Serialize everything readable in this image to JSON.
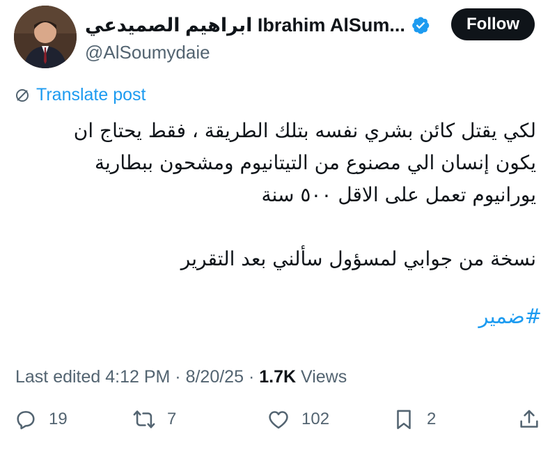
{
  "author": {
    "display_name": "ابراهيم الصميدعي Ibrahim AlSum...",
    "handle": "@AlSoumydaie",
    "verified": true
  },
  "follow_label": "Follow",
  "translate_label": "Translate post",
  "post": {
    "lines": [
      "لكي يقتل كائن بشري  نفسه بتلك الطريقة ، فقط يحتاج ان",
      "يكون إنسان الي مصنوع من التيتانيوم ومشحون ببطارية",
      "يورانيوم تعمل على الاقل ٥٠٠ سنة",
      "نسخة من جوابي لمسؤول سألني  بعد التقرير"
    ],
    "hashtag": "#ضمير"
  },
  "meta": {
    "edited": "Last edited 4:12 PM · 8/20/25",
    "separator": " · ",
    "views_count": "1.7K",
    "views_label": " Views"
  },
  "actions": {
    "replies": "19",
    "reposts": "7",
    "likes": "102",
    "bookmarks": "2"
  },
  "colors": {
    "accent": "#1d9bf0",
    "text": "#0f1419",
    "secondary": "#536471"
  }
}
